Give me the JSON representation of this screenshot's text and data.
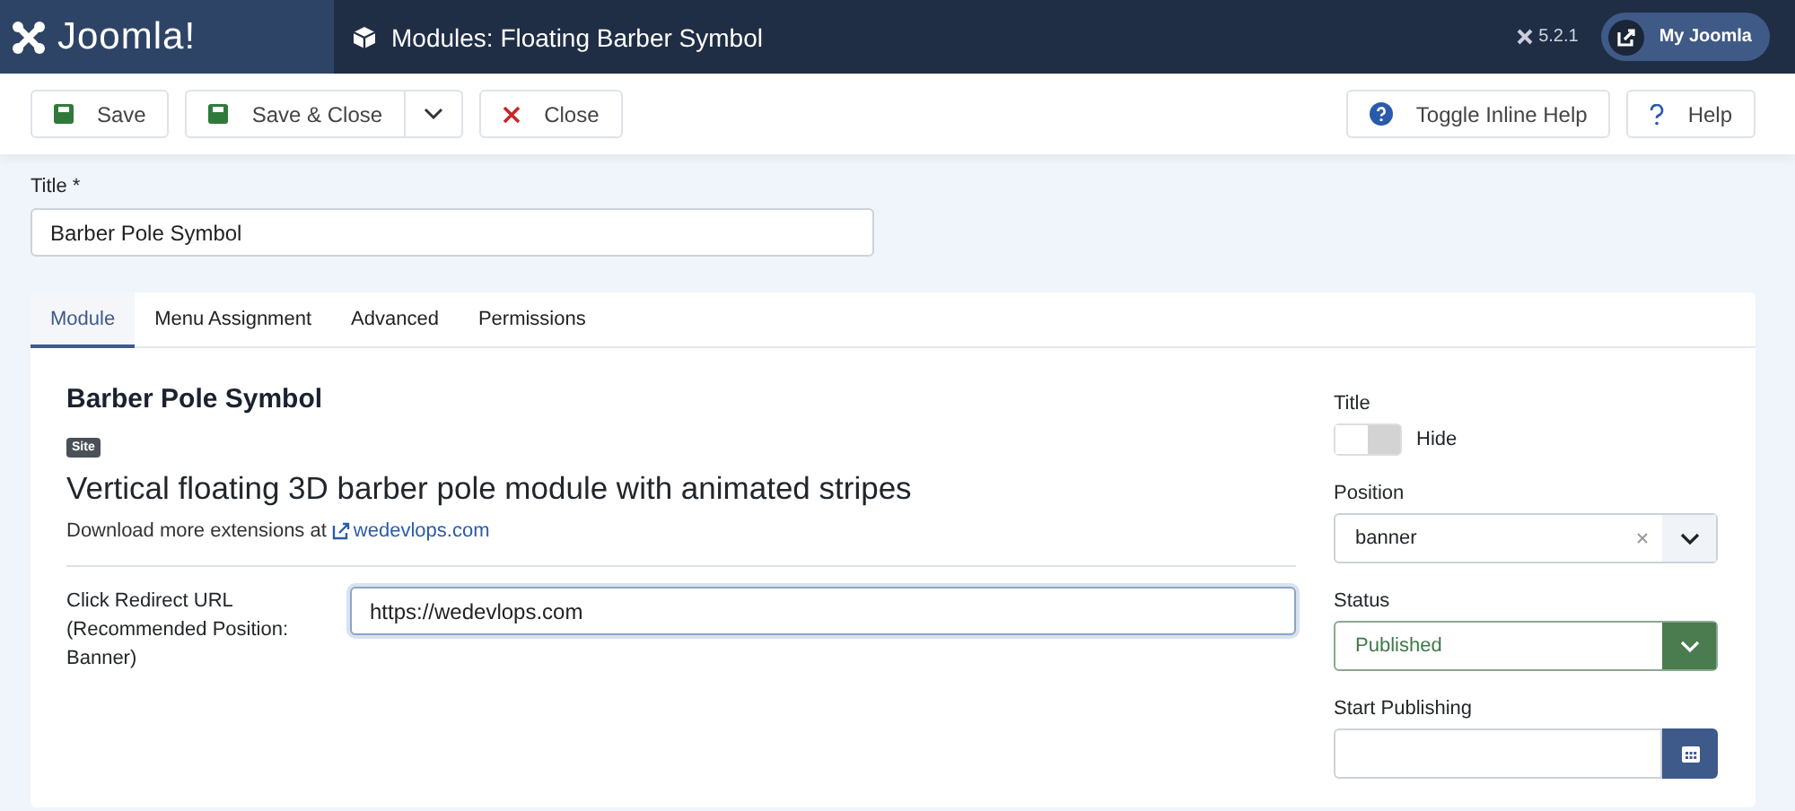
{
  "header": {
    "brand": "Joomla!",
    "page_title": "Modules: Floating Barber Symbol",
    "version": "5.2.1",
    "user_button": "My Joomla"
  },
  "toolbar": {
    "left": [
      {
        "label": "Save",
        "kind": "save"
      },
      {
        "label": "Save & Close",
        "kind": "save-split"
      },
      {
        "label": "Close",
        "kind": "close"
      }
    ],
    "right": [
      {
        "label": "Toggle Inline Help",
        "kind": "inline-help"
      },
      {
        "label": "Help",
        "kind": "help"
      }
    ]
  },
  "title_field": {
    "label": "Title *",
    "value": "Barber Pole Symbol"
  },
  "tabs": [
    {
      "label": "Module",
      "selected": true
    },
    {
      "label": "Menu Assignment",
      "selected": false
    },
    {
      "label": "Advanced",
      "selected": false
    },
    {
      "label": "Permissions",
      "selected": false
    }
  ],
  "module": {
    "name": "Barber Pole Symbol",
    "badge": "Site",
    "description": "Vertical floating 3D barber pole module with animated stripes",
    "download_text": "Download more extensions at",
    "download_link": "wedevlops.com",
    "fields": [
      {
        "label": "Click Redirect URL (Recommended Position: Banner)",
        "value": "https://wedevlops.com"
      }
    ]
  },
  "sidebar": {
    "title_toggle": {
      "label": "Title",
      "state_text": "Hide",
      "on": false
    },
    "position": {
      "label": "Position",
      "value": "banner"
    },
    "status": {
      "label": "Status",
      "value": "Published"
    },
    "start_publishing": {
      "label": "Start Publishing"
    }
  }
}
